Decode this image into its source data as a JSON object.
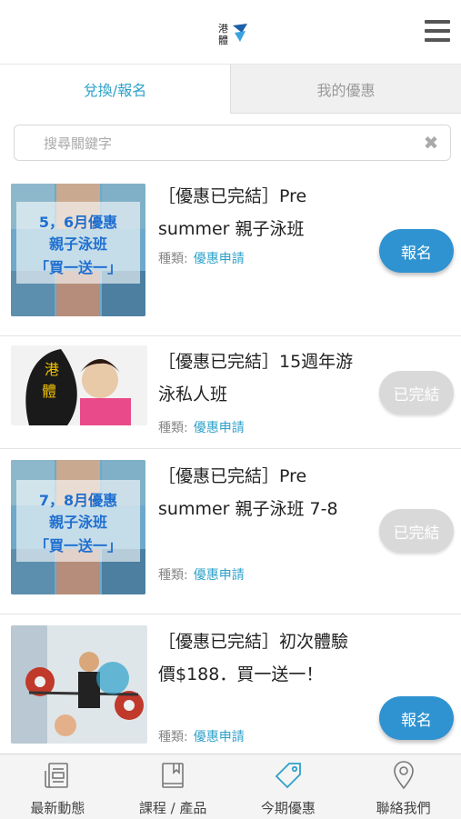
{
  "header": {
    "logo_alt": "港體"
  },
  "tabs": [
    {
      "label": "兌換/報名",
      "active": true
    },
    {
      "label": "我的優惠",
      "active": false
    }
  ],
  "search": {
    "placeholder": "搜尋關鍵字",
    "value": ""
  },
  "offers": [
    {
      "title": "［優惠已完結］Pre summer 親子泳班",
      "category_label": "種類:",
      "category": "優惠申請",
      "button": "報名",
      "status": "enroll",
      "thumb_text": [
        "5，6月優惠",
        "親子泳班",
        "「買一送一」"
      ]
    },
    {
      "title": "［優惠已完結］15週年游泳私人班",
      "category_label": "種類:",
      "category": "優惠申請",
      "button": "已完結",
      "status": "done",
      "thumb_text": [
        "港",
        "體"
      ]
    },
    {
      "title": "［優惠已完結］Pre summer 親子泳班 7-8",
      "category_label": "種類:",
      "category": "優惠申請",
      "button": "已完結",
      "status": "done",
      "thumb_text": [
        "7，8月優惠",
        "親子泳班",
        "「買一送一」"
      ]
    },
    {
      "title": "［優惠已完結］初次體驗價$188．買一送一！",
      "category_label": "種類:",
      "category": "優惠申請",
      "button": "報名",
      "status": "enroll",
      "thumb_text": []
    }
  ],
  "bottom_nav": [
    {
      "label": "最新動態",
      "icon": "news-icon"
    },
    {
      "label": "課程 / 產品",
      "icon": "book-icon"
    },
    {
      "label": "今期優惠",
      "icon": "tag-icon"
    },
    {
      "label": "聯絡我們",
      "icon": "location-pin-icon"
    }
  ],
  "colors": {
    "accent": "#2ea1c9",
    "button_blue": "#2f93d1",
    "button_done": "#d9d9d9"
  }
}
